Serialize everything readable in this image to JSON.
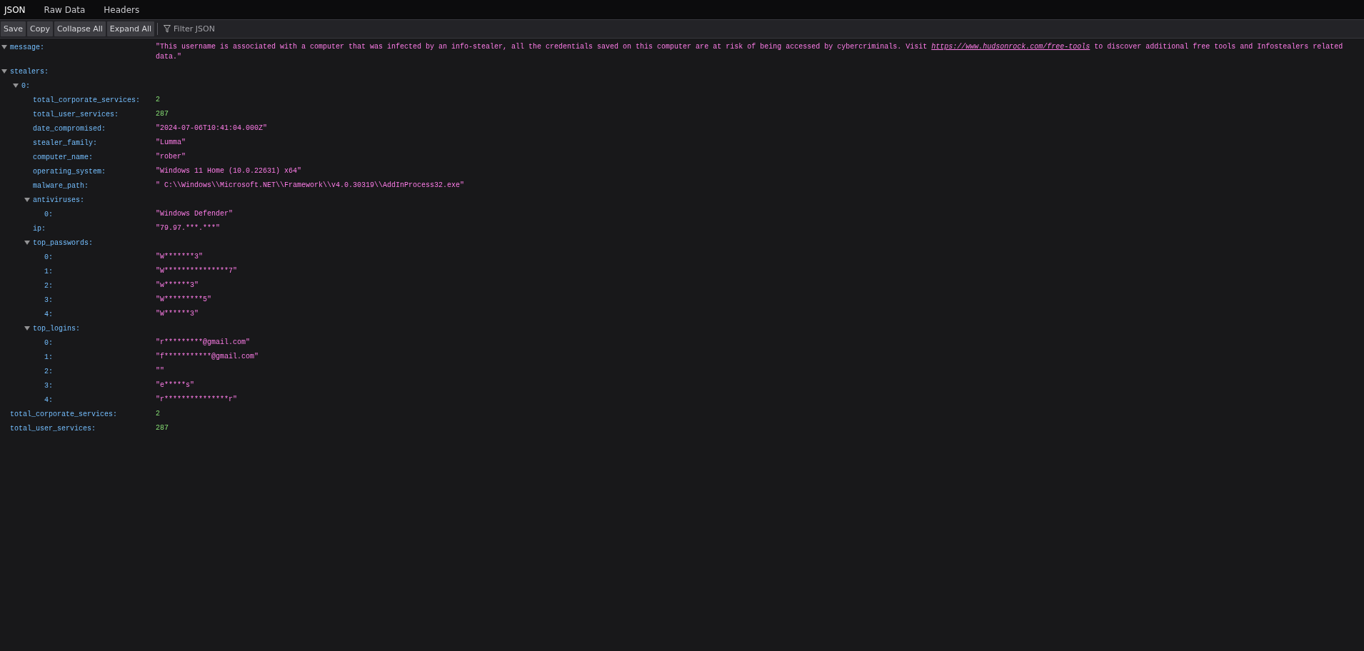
{
  "tabs": [
    {
      "label": "JSON",
      "selected": true
    },
    {
      "label": "Raw Data",
      "selected": false
    },
    {
      "label": "Headers",
      "selected": false
    }
  ],
  "toolbar": {
    "buttons": [
      "Save",
      "Copy",
      "Collapse All",
      "Expand All"
    ],
    "filter": {
      "placeholder": "Filter JSON"
    }
  },
  "tree": [
    {
      "key": "message:",
      "kind": "string",
      "parts": [
        {
          "kind": "text",
          "text": "\"This username is associated with a computer that was infected by an info-stealer, all the credentials saved on this computer are at risk of being accessed by cybercriminals. Visit "
        },
        {
          "kind": "link",
          "text": "https://www.hudsonrock.com/free-tools"
        },
        {
          "kind": "text",
          "text": " to discover additional free tools and Infostealers related data.\""
        }
      ],
      "expanded": true
    },
    {
      "key": "stealers:",
      "kind": "object",
      "expanded": true,
      "children": [
        {
          "key": "0:",
          "kind": "object",
          "expanded": true,
          "children": [
            {
              "key": "total_corporate_services:",
              "kind": "number",
              "value": "2"
            },
            {
              "key": "total_user_services:",
              "kind": "number",
              "value": "287"
            },
            {
              "key": "date_compromised:",
              "kind": "string",
              "value": "\"2024-07-06T10:41:04.000Z\""
            },
            {
              "key": "stealer_family:",
              "kind": "string",
              "value": "\"Lumma\""
            },
            {
              "key": "computer_name:",
              "kind": "string",
              "value": "\"rober\""
            },
            {
              "key": "operating_system:",
              "kind": "string",
              "value": "\"Windows 11 Home (10.0.22631) x64\""
            },
            {
              "key": "malware_path:",
              "kind": "string",
              "value": "\" C:\\\\Windows\\\\Microsoft.NET\\\\Framework\\\\v4.0.30319\\\\AddInProcess32.exe\""
            },
            {
              "key": "antiviruses:",
              "kind": "object",
              "expanded": true,
              "children": [
                {
                  "key": "0:",
                  "kind": "string",
                  "value": "\"Windows Defender\""
                }
              ]
            },
            {
              "key": "ip:",
              "kind": "string",
              "value": "\"79.97.***.***\""
            },
            {
              "key": "top_passwords:",
              "kind": "object",
              "expanded": true,
              "children": [
                {
                  "key": "0:",
                  "kind": "string",
                  "value": "\"W*******3\""
                },
                {
                  "key": "1:",
                  "kind": "string",
                  "value": "\"W***************7\""
                },
                {
                  "key": "2:",
                  "kind": "string",
                  "value": "\"w******3\""
                },
                {
                  "key": "3:",
                  "kind": "string",
                  "value": "\"W*********5\""
                },
                {
                  "key": "4:",
                  "kind": "string",
                  "value": "\"W******3\""
                }
              ]
            },
            {
              "key": "top_logins:",
              "kind": "object",
              "expanded": true,
              "children": [
                {
                  "key": "0:",
                  "kind": "string",
                  "value": "\"r*********@gmail.com\""
                },
                {
                  "key": "1:",
                  "kind": "string",
                  "value": "\"f***********@gmail.com\""
                },
                {
                  "key": "2:",
                  "kind": "string",
                  "value": "\"\""
                },
                {
                  "key": "3:",
                  "kind": "string",
                  "value": "\"e*****s\""
                },
                {
                  "key": "4:",
                  "kind": "string",
                  "value": "\"r***************r\""
                }
              ]
            }
          ]
        }
      ]
    },
    {
      "key": "total_corporate_services:",
      "kind": "number",
      "value": "2"
    },
    {
      "key": "total_user_services:",
      "kind": "number",
      "value": "287"
    }
  ]
}
